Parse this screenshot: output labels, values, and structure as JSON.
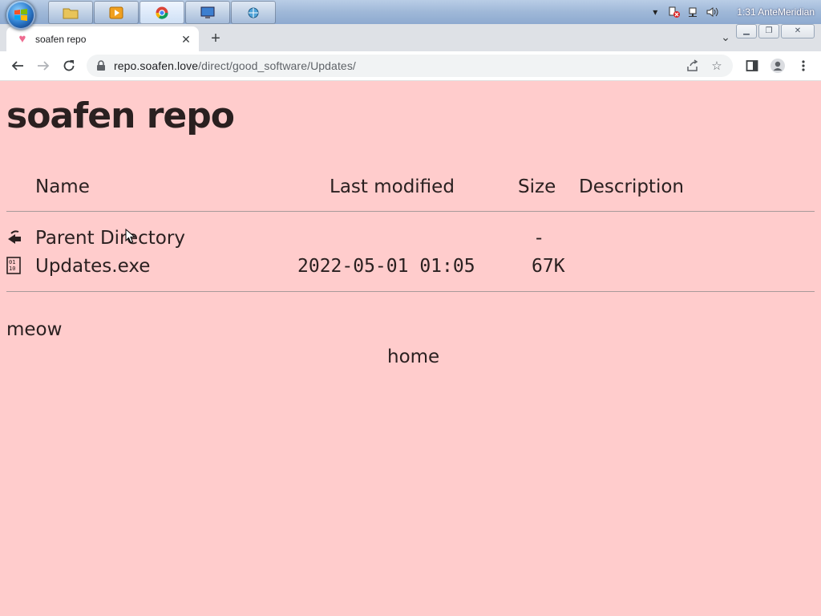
{
  "taskbar": {
    "buttons": [
      "file-explorer",
      "media-player",
      "chrome",
      "remote-desktop",
      "network-tool"
    ],
    "clock": "1:31 AnteMeridian"
  },
  "browser": {
    "tab_title": "soafen repo",
    "url_host": "repo.soafen.love",
    "url_path": "/direct/good_software/Updates/"
  },
  "page": {
    "title": "soafen repo",
    "headers": {
      "name": "Name",
      "last_modified": "Last modified",
      "size": "Size",
      "description": "Description"
    },
    "rows": [
      {
        "icon": "back-icon",
        "name": "Parent Directory",
        "last_modified": "",
        "size": "-",
        "description": ""
      },
      {
        "icon": "binary-file-icon",
        "name": "Updates.exe",
        "last_modified": "2022-05-01 01:05",
        "size": "67K",
        "description": ""
      }
    ],
    "footer_text": "meow",
    "home_link": "home"
  },
  "colors": {
    "page_background": "#ffcccc",
    "text": "#2a2020"
  }
}
